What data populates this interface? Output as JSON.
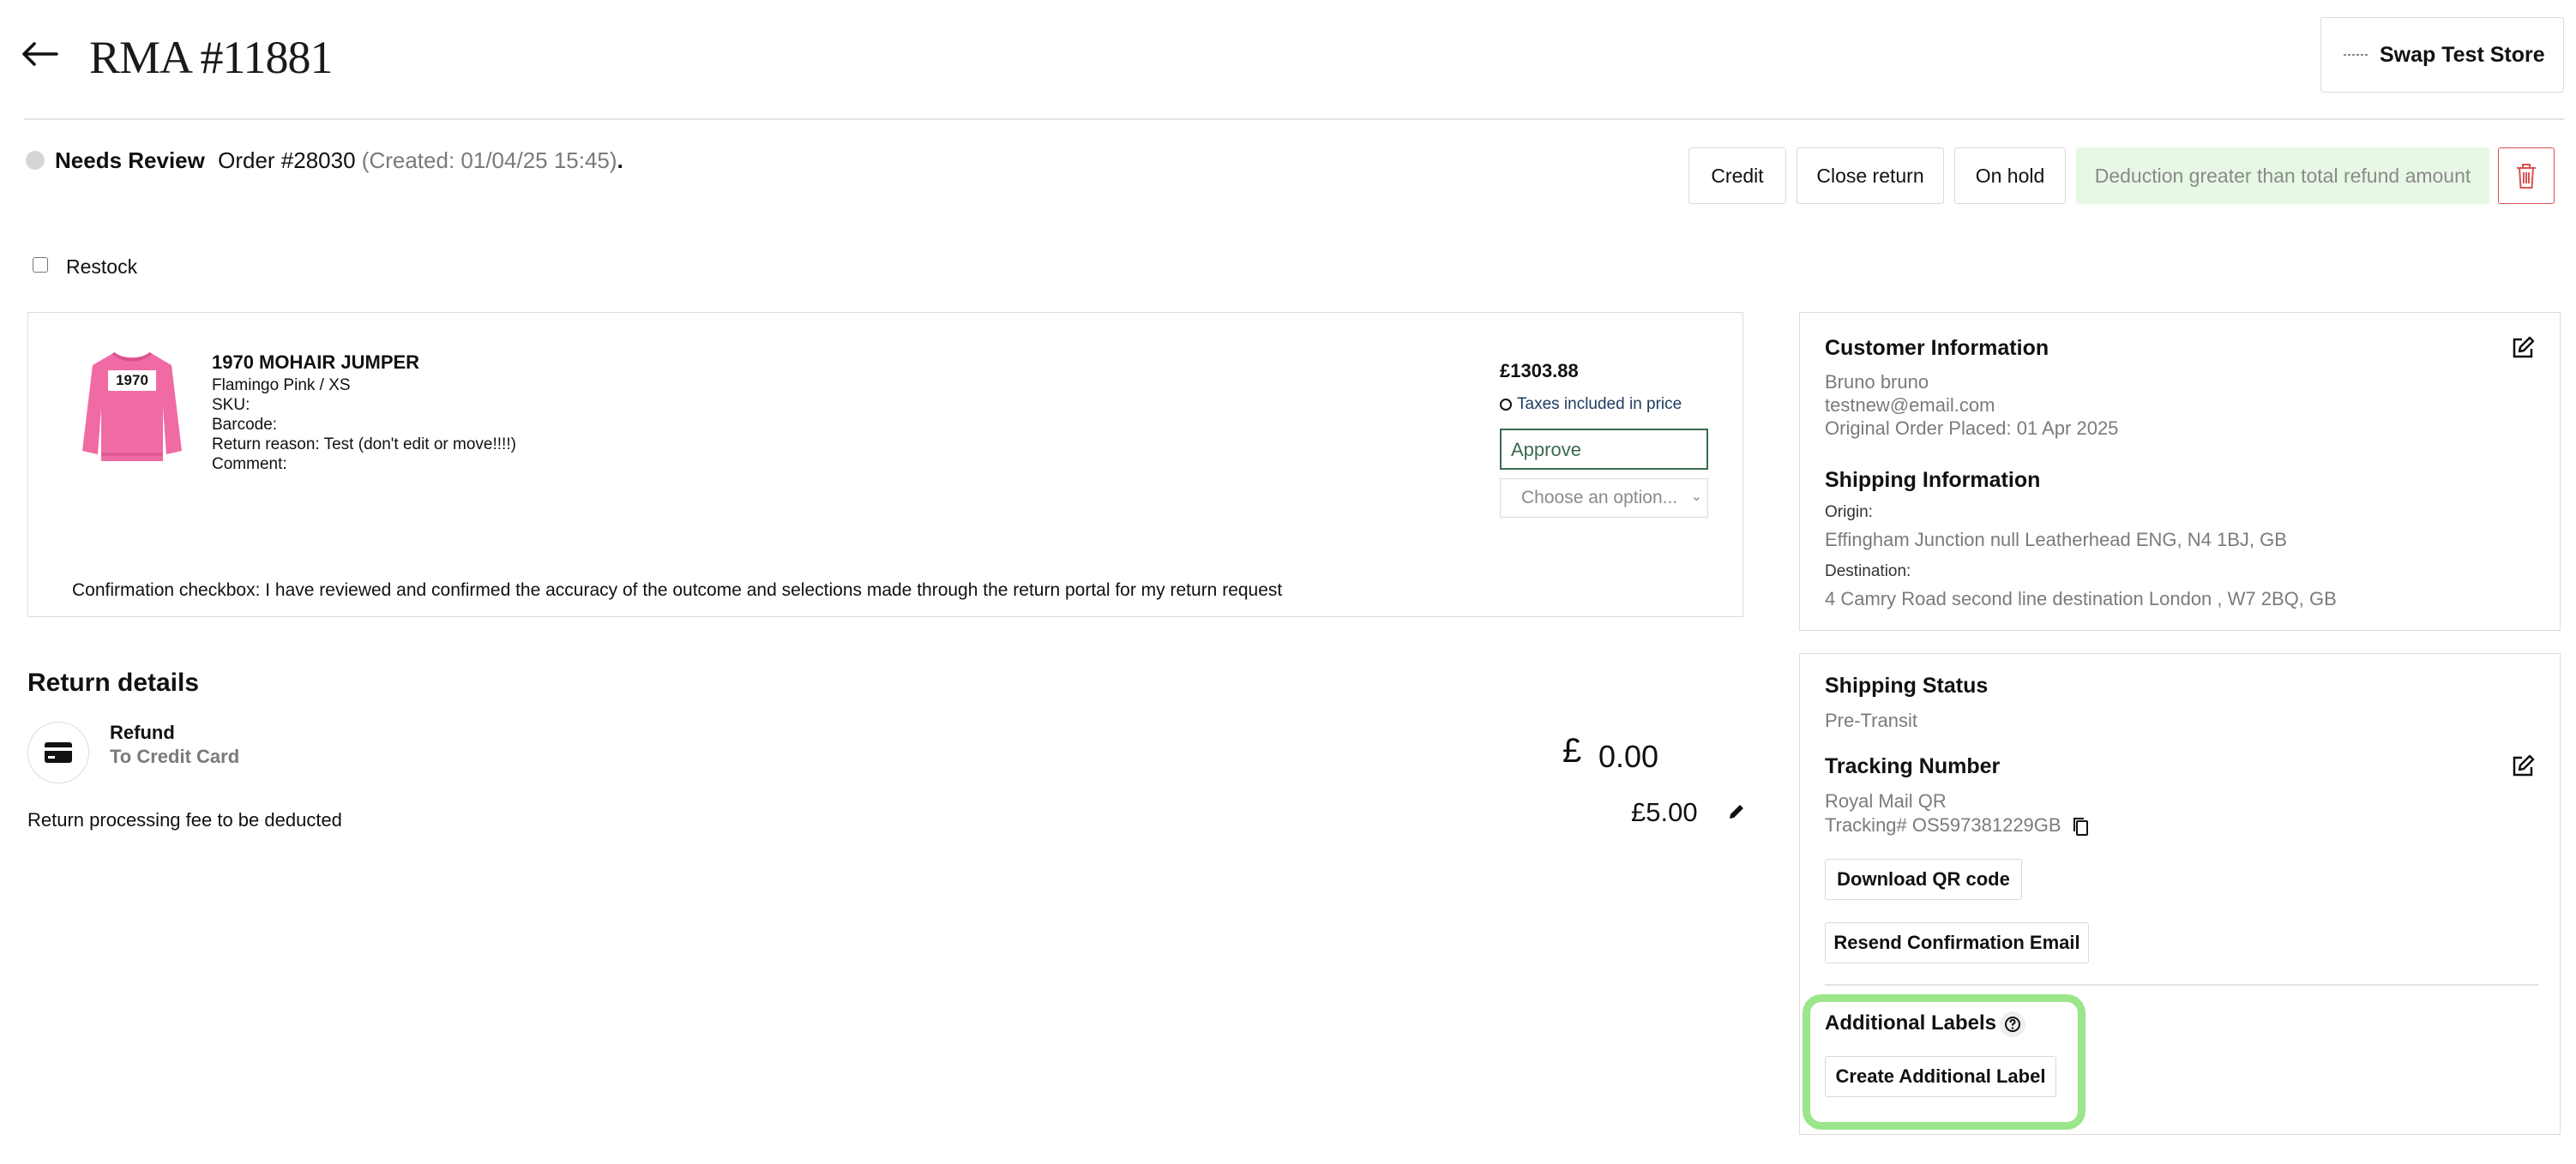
{
  "header": {
    "title": "RMA #11881",
    "store_button": "Swap Test Store"
  },
  "status": {
    "label": "Needs Review",
    "order": "Order #28030",
    "created": "(Created: 01/04/25 15:45)",
    "period": "."
  },
  "actions": {
    "credit": "Credit",
    "close_return": "Close return",
    "on_hold": "On hold",
    "deduction_notice": "Deduction greater than total refund amount"
  },
  "restock": {
    "label": "Restock",
    "checked": false
  },
  "item": {
    "name": "1970 MOHAIR JUMPER",
    "variant": "Flamingo Pink / XS",
    "sku": "SKU:",
    "barcode": "Barcode:",
    "return_reason": "Return reason: Test (don't edit or move!!!!)",
    "comment": "Comment:",
    "price": "£1303.88",
    "tax_note": "Taxes included in price",
    "approve": "Approve",
    "choose_placeholder": "Choose an option...",
    "image_text": "1970",
    "confirmation": "Confirmation checkbox: I have reviewed and confirmed the accuracy of the outcome and selections made through the return portal for my return request"
  },
  "return_details": {
    "title": "Return details",
    "refund_label": "Refund",
    "refund_method": "To Credit Card",
    "currency_symbol": "£",
    "amount": "0.00",
    "fee_label": "Return processing fee to be deducted",
    "fee_amount": "£5.00"
  },
  "customer": {
    "title": "Customer Information",
    "name": "Bruno bruno",
    "email": "testnew@email.com",
    "order_placed": "Original Order Placed: 01 Apr 2025"
  },
  "shipping_info": {
    "title": "Shipping Information",
    "origin_label": "Origin:",
    "origin": "Effingham Junction null Leatherhead ENG, N4 1BJ, GB",
    "destination_label": "Destination:",
    "destination": "4 Camry Road second line destination London , W7 2BQ, GB"
  },
  "shipping_status": {
    "title": "Shipping Status",
    "status": "Pre-Transit",
    "tracking_title": "Tracking Number",
    "carrier": "Royal Mail QR",
    "tracking": "Tracking# OS597381229GB",
    "download_qr": "Download QR code",
    "resend_email": "Resend Confirmation Email"
  },
  "additional_labels": {
    "title": "Additional Labels",
    "create_button": "Create Additional Label",
    "highlight_color": "#9be58b"
  },
  "icons": {
    "back": "arrow-left-icon",
    "store": "store-dash-icon",
    "trash": "trash-icon",
    "edit": "edit-square-icon",
    "card": "credit-card-icon",
    "pencil": "pencil-icon",
    "copy": "copy-icon",
    "help": "question-circle-icon"
  },
  "colors": {
    "deduction_bg": "#e7f8e4",
    "trash_red": "#d9534f",
    "approve_green": "#3a6b4d",
    "tax_blue": "#1f3a5f"
  }
}
